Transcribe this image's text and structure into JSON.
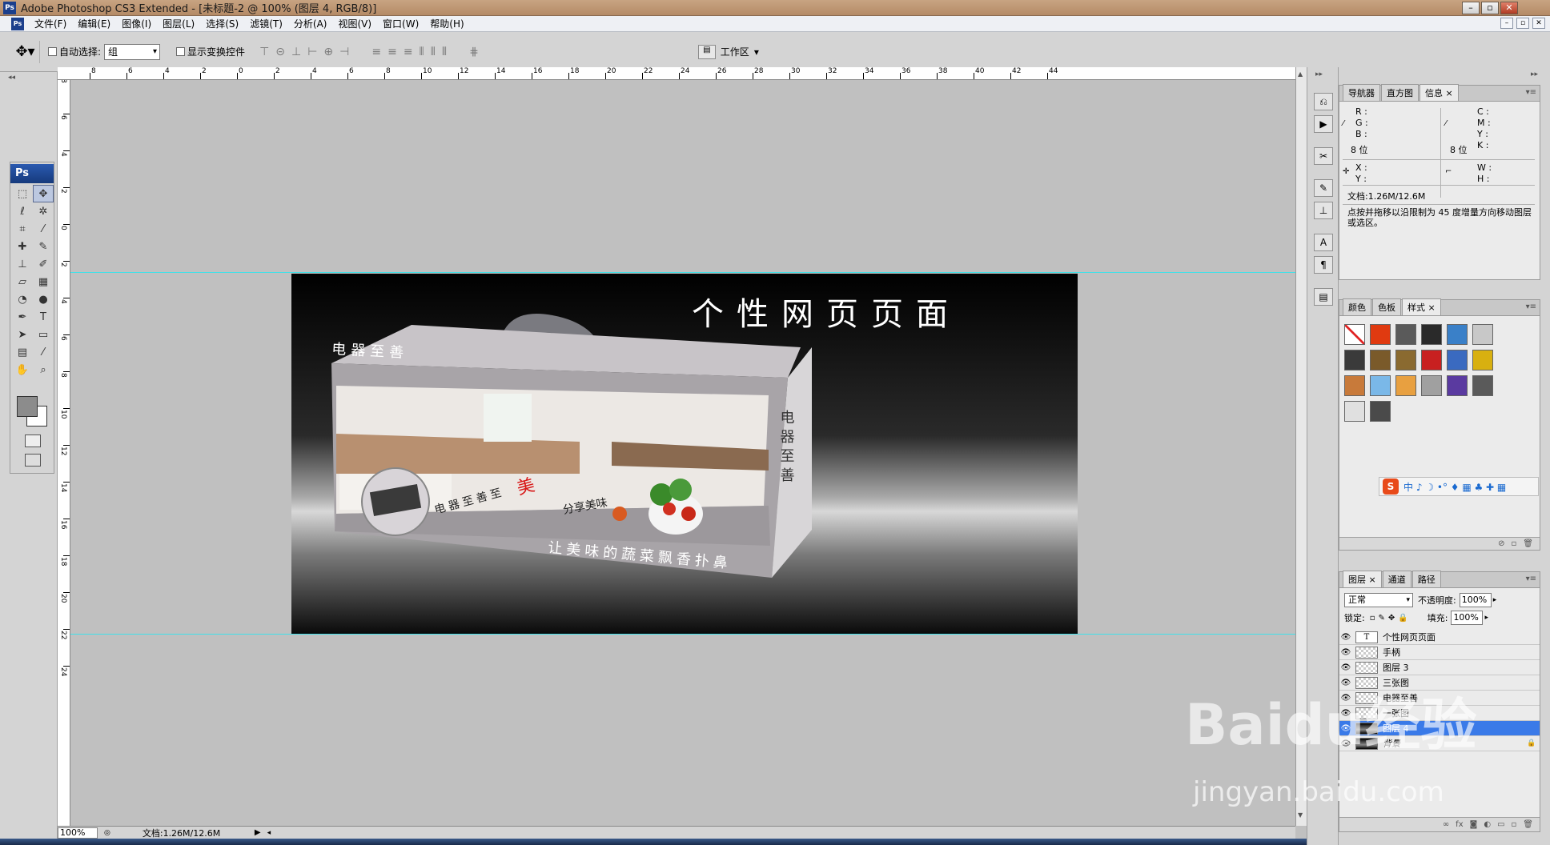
{
  "window": {
    "title": "Adobe Photoshop CS3 Extended - [未标题-2 @ 100% (图层 4, RGB/8)]",
    "logo": "Ps"
  },
  "menu": [
    "文件(F)",
    "编辑(E)",
    "图像(I)",
    "图层(L)",
    "选择(S)",
    "滤镜(T)",
    "分析(A)",
    "视图(V)",
    "窗口(W)",
    "帮助(H)"
  ],
  "options": {
    "auto_select_label": "自动选择:",
    "auto_select_value": "组",
    "show_transform_label": "显示变换控件",
    "workspace_label": "工作区"
  },
  "toolbox": {
    "badge": "Ps"
  },
  "ruler": {
    "top_labels": [
      "8",
      "6",
      "4",
      "2",
      "0",
      "2",
      "4",
      "6",
      "8",
      "10",
      "12",
      "14",
      "16",
      "18",
      "20",
      "22",
      "24",
      "26",
      "28",
      "30",
      "32",
      "34",
      "36",
      "38",
      "40",
      "42",
      "44"
    ],
    "left_labels": [
      "8",
      "6",
      "4",
      "2",
      "0",
      "2",
      "4",
      "6",
      "8",
      "10",
      "12",
      "14",
      "16",
      "18",
      "20",
      "22",
      "24"
    ]
  },
  "canvas": {
    "headline": "个性网页页面",
    "box_top_label": "电器至善",
    "box_side_label": "电器至善",
    "box_banner": "电器至善至",
    "box_banner_red": "美",
    "box_slogan": "分享美味",
    "box_bottom": "让美味的蔬菜飘香扑鼻"
  },
  "status": {
    "zoom": "100%",
    "docinfo": "文档:1.26M/12.6M"
  },
  "info_panel": {
    "tabs": [
      "导航器",
      "直方图",
      "信息"
    ],
    "active_tab": "信息",
    "left_labels": [
      "R :",
      "G :",
      "B :"
    ],
    "right_labels": [
      "C :",
      "M :",
      "Y :",
      "K :"
    ],
    "bits_left": "8 位",
    "bits_right": "8 位",
    "xy": [
      "X :",
      "Y :"
    ],
    "wh": [
      "W :",
      "H :"
    ],
    "docinfo": "文档:1.26M/12.6M",
    "hint": "点按并拖移以沿限制为 45 度增量方向移动图层或选区。"
  },
  "styles_panel": {
    "tabs": [
      "颜色",
      "色板",
      "样式"
    ],
    "active_tab": "样式",
    "swatch_colors": [
      "#ffffff",
      "#e03a10",
      "#5a5a5a",
      "#2a2a2a",
      "#3a80c8",
      "#c8c8c8",
      "#3a3a3a",
      "#7a5a2a",
      "#8a6a30",
      "#c82020",
      "#3a6ac0",
      "#d8b010",
      "#c87a3a",
      "#7ab8e8",
      "#e8a040",
      "#a0a0a0",
      "#5a3aa0",
      "#5a5a5a",
      "#e0e0e0",
      "#4a4a4a"
    ]
  },
  "ime": {
    "logo": "S",
    "text": "中 ♪ ☽ •° ♦ ▦ ♣ ✚ ▦"
  },
  "layers_panel": {
    "tabs": [
      "图层",
      "通道",
      "路径"
    ],
    "active_tab": "图层",
    "blend_mode": "正常",
    "opacity_label": "不透明度:",
    "opacity": "100%",
    "lock_label": "锁定:",
    "fill_label": "填充:",
    "fill": "100%",
    "layers": [
      {
        "name": "个性网页页面",
        "type": "text",
        "selected": false
      },
      {
        "name": "手柄",
        "type": "transparent",
        "selected": false
      },
      {
        "name": "图层 3",
        "type": "transparent",
        "selected": false
      },
      {
        "name": "三张图",
        "type": "transparent",
        "selected": false
      },
      {
        "name": "电器至善",
        "type": "transparent",
        "selected": false
      },
      {
        "name": "一张图",
        "type": "transparent",
        "selected": false
      },
      {
        "name": "图层 4",
        "type": "dark",
        "selected": true
      },
      {
        "name": "背景",
        "type": "dark",
        "selected": false,
        "locked": true
      }
    ]
  },
  "watermark": {
    "brand": "Baidu经验",
    "url": "jingyan.baidu.com"
  }
}
